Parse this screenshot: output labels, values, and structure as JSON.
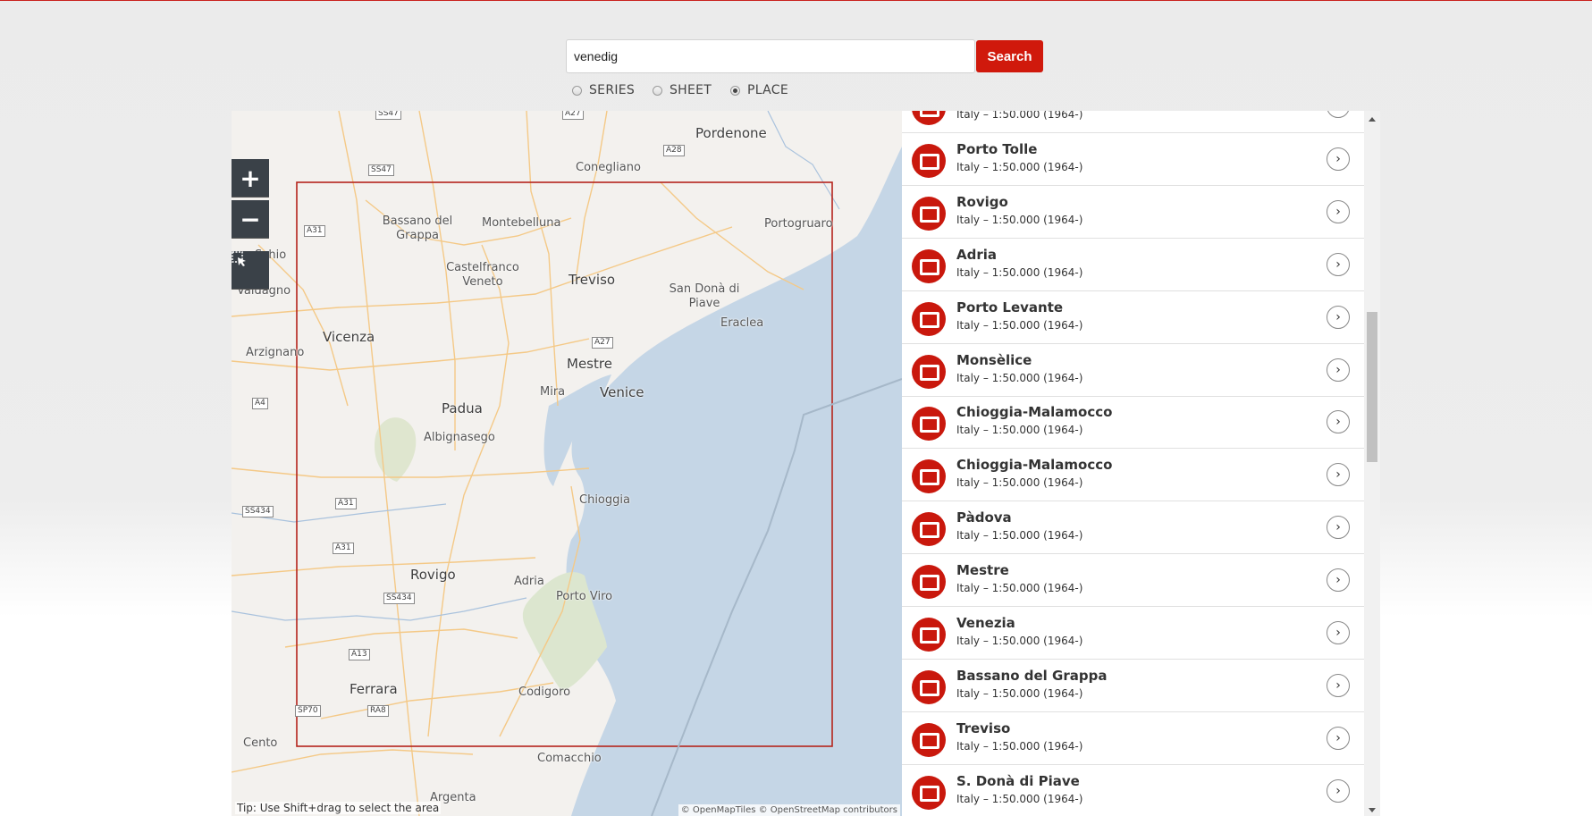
{
  "search": {
    "value": "venedig",
    "button_label": "Search"
  },
  "search_modes": [
    {
      "label": "SERIES",
      "selected": false
    },
    {
      "label": "SHEET",
      "selected": false
    },
    {
      "label": "PLACE",
      "selected": true
    }
  ],
  "map": {
    "zoom_in": "+",
    "zoom_out": "−",
    "tip": "Tip: Use Shift+drag to select the area",
    "attribution": "© OpenMapTiles © OpenStreetMap contributors",
    "places": [
      "Pordenone",
      "Conegliano",
      "Bassano del Grappa",
      "Montebelluna",
      "Portogruaro",
      "Schio",
      "Valdagno",
      "Castelfranco Veneto",
      "Treviso",
      "San Donà di Piave",
      "Eraclea",
      "Vicenza",
      "Arzignano",
      "Mestre",
      "Mira",
      "Venice",
      "Padua",
      "Albignasego",
      "Chioggia",
      "Rovigo",
      "Adria",
      "Porto Viro",
      "Ferrara",
      "Codigoro",
      "Cento",
      "Comacchio",
      "Argenta"
    ],
    "roads": [
      "SS47",
      "A27",
      "A28",
      "A31",
      "A4",
      "SS434",
      "A13",
      "SP70",
      "RA8"
    ],
    "colors": {
      "sea": "#c5d6e6",
      "land": "#f3f1ee",
      "selection": "#b5241c",
      "roads": "#f4c987"
    }
  },
  "results": [
    {
      "name": "",
      "desc": "Italy – 1:50.000 (1964-)"
    },
    {
      "name": "Porto Tolle",
      "desc": "Italy – 1:50.000 (1964-)"
    },
    {
      "name": "Rovigo",
      "desc": "Italy – 1:50.000 (1964-)"
    },
    {
      "name": "Adria",
      "desc": "Italy – 1:50.000 (1964-)"
    },
    {
      "name": "Porto Levante",
      "desc": "Italy – 1:50.000 (1964-)"
    },
    {
      "name": "Monsèlice",
      "desc": "Italy – 1:50.000 (1964-)"
    },
    {
      "name": "Chioggia-Malamocco",
      "desc": "Italy – 1:50.000 (1964-)"
    },
    {
      "name": "Chioggia-Malamocco",
      "desc": "Italy – 1:50.000 (1964-)"
    },
    {
      "name": "Pàdova",
      "desc": "Italy – 1:50.000 (1964-)"
    },
    {
      "name": "Mestre",
      "desc": "Italy – 1:50.000 (1964-)"
    },
    {
      "name": "Venezia",
      "desc": "Italy – 1:50.000 (1964-)"
    },
    {
      "name": "Bassano del Grappa",
      "desc": "Italy – 1:50.000 (1964-)"
    },
    {
      "name": "Treviso",
      "desc": "Italy – 1:50.000 (1964-)"
    },
    {
      "name": "S. Donà di Piave",
      "desc": "Italy – 1:50.000 (1964-)"
    }
  ],
  "icons": {
    "result": "map-sheet-icon",
    "open": "chevron-right-icon",
    "select": "select-area-icon"
  }
}
